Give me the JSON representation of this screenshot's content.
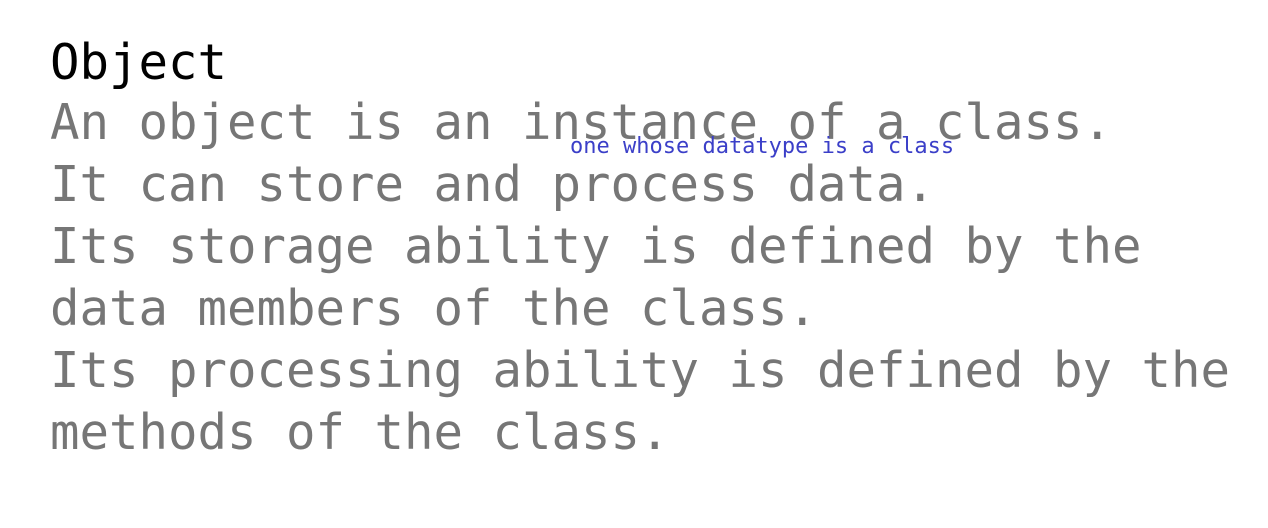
{
  "title": "Object",
  "lines": [
    "An object is an instance of a class.",
    "It can store and process data.",
    "Its storage ability is defined by the",
    "data members of the class.",
    "Its processing ability is defined by the",
    "methods of the class."
  ],
  "annotation": {
    "text": "one whose datatype is a class",
    "color": "#3b3fc8"
  },
  "colors": {
    "title": "#000000",
    "body_text": "#767676",
    "background": "#ffffff"
  }
}
